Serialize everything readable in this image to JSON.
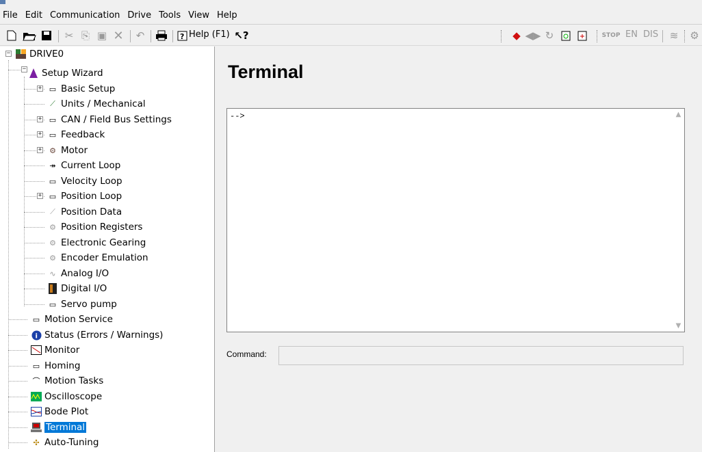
{
  "menu": [
    "File",
    "Edit",
    "Communication",
    "Drive",
    "Tools",
    "View",
    "Help"
  ],
  "toolbar": {
    "help_label": "Help (F1)",
    "en_label": "EN",
    "dis_label": "DIS",
    "stop_label": "STOP"
  },
  "tree": {
    "root": "DRIVE0",
    "wizard": "Setup Wizard",
    "wizard_items": [
      "Basic Setup",
      "Units / Mechanical",
      "CAN / Field Bus Settings",
      "Feedback",
      "Motor",
      "Current Loop",
      "Velocity Loop",
      "Position Loop",
      "Position Data",
      "Position Registers",
      "Electronic Gearing",
      "Encoder Emulation",
      "Analog I/O",
      "Digital I/O",
      "Servo pump"
    ],
    "items": [
      "Motion Service",
      "Status (Errors / Warnings)",
      "Monitor",
      "Homing",
      "Motion Tasks",
      "Oscilloscope",
      "Bode Plot",
      "Terminal",
      "Auto-Tuning"
    ]
  },
  "main": {
    "title": "Terminal",
    "terminal_text": "-->",
    "command_label": "Command:",
    "command_value": ""
  },
  "colors": {
    "selection": "#0078d7"
  }
}
